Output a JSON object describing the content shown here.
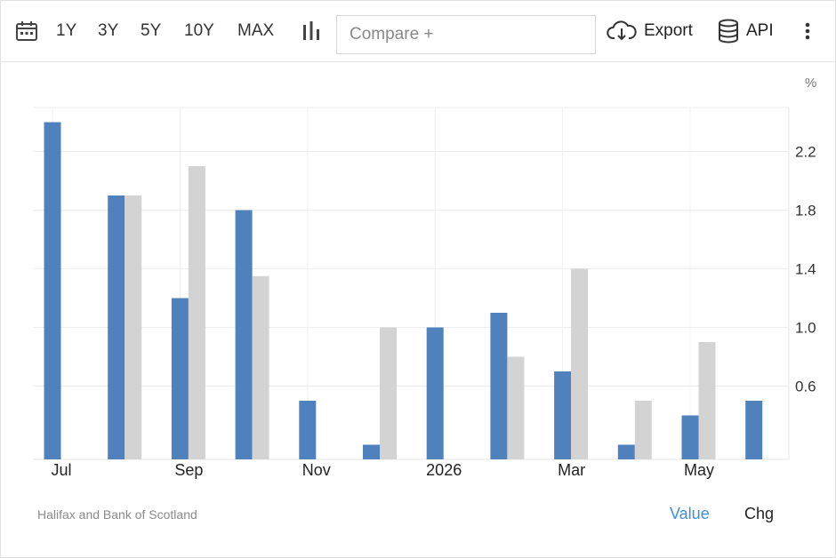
{
  "toolbar": {
    "calendar_icon": "calendar-icon",
    "ranges": [
      "1Y",
      "3Y",
      "5Y",
      "10Y",
      "MAX"
    ],
    "chart_type_icon": "bar-chart-icon",
    "compare_placeholder": "Compare +",
    "export_label": "Export",
    "export_icon": "cloud-download-icon",
    "api_label": "API",
    "api_icon": "database-icon",
    "more_icon": "more-vertical-icon"
  },
  "footer": {
    "source": "Halifax and Bank of Scotland",
    "value_label": "Value",
    "chg_label": "Chg"
  },
  "colors": {
    "value_series": "#4f81bd",
    "chg_series": "#d3d3d3",
    "link": "#3f8ee0"
  },
  "chart_data": {
    "type": "bar",
    "unit_label": "%",
    "categories": [
      "Jul 2025",
      "Aug 2025",
      "Sep 2025",
      "Oct 2025",
      "Nov 2025",
      "Dec 2025",
      "Jan 2026",
      "Feb 2026",
      "Mar 2026",
      "Apr 2026",
      "May 2026",
      "Jun 2026"
    ],
    "x_tick_labels": [
      {
        "index": 0,
        "label": "Jul"
      },
      {
        "index": 2,
        "label": "Sep"
      },
      {
        "index": 4,
        "label": "Nov"
      },
      {
        "index": 6,
        "label": "2026"
      },
      {
        "index": 8,
        "label": "Mar"
      },
      {
        "index": 10,
        "label": "May"
      }
    ],
    "series": [
      {
        "name": "Value",
        "values": [
          2.4,
          1.9,
          1.2,
          1.8,
          0.5,
          0.2,
          1.0,
          1.1,
          0.7,
          0.2,
          0.4,
          0.5
        ]
      },
      {
        "name": "Chg",
        "values": [
          null,
          1.9,
          2.1,
          1.35,
          null,
          1.0,
          null,
          0.8,
          1.4,
          0.5,
          0.9,
          null
        ]
      }
    ],
    "y_ticks": [
      0.6,
      1.0,
      1.4,
      1.8,
      2.2
    ],
    "ylim": [
      0.1,
      2.5
    ],
    "y_axis_position": "right",
    "grid": true
  }
}
